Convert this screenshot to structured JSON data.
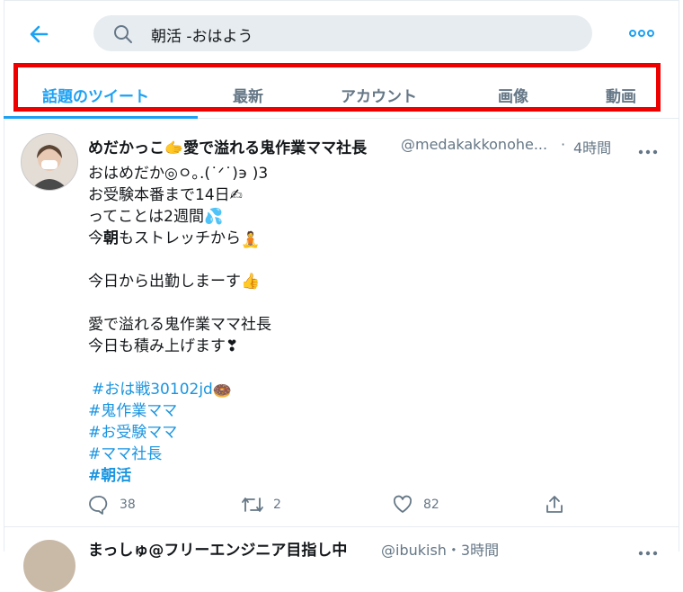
{
  "header": {
    "back_icon": "arrow-left-icon",
    "search_query": "朝活 -おはよう",
    "more_icon": "more-horizontal-icon"
  },
  "tabs": [
    {
      "label": "話題のツイート",
      "active": true
    },
    {
      "label": "最新",
      "active": false
    },
    {
      "label": "アカウント",
      "active": false
    },
    {
      "label": "画像",
      "active": false
    },
    {
      "label": "動画",
      "active": false
    }
  ],
  "tweet": {
    "display_name": "めだかっこ🫱愛で溢れる鬼作業ママ社長",
    "handle": "@medakakkonohe...",
    "separator": "·",
    "time": "4時間",
    "lines": [
      "おはめだか◎ㅇ｡.(˙ᐟ˙)϶ )3",
      "お受験本番まで14日✍",
      "ってことは2週間💦",
      "今朝もストレッチから🧘",
      "",
      "今日から出勤しまーす👍",
      "",
      "愛で溢れる鬼作業ママ社長",
      "今日も積み上げます❣",
      "",
      "#おは戦30102jd🍩",
      "#鬼作業ママ",
      "#お受験ママ",
      "#ママ社長",
      "#朝活"
    ],
    "line3_prefix": "今",
    "line3_bold": "朝",
    "line3_suffix": "もストレッチから",
    "hashtags": {
      "h1": "#おは戦30102jd",
      "h2": "#鬼作業ママ",
      "h3": "#お受験ママ",
      "h4": "#ママ社長",
      "h5": "#朝活"
    },
    "actions": {
      "reply_count": "38",
      "retweet_count": "2",
      "like_count": "82"
    }
  },
  "next_tweet": {
    "display_name": "まっしゅ@フリーエンジニア目指し中",
    "handle": "@ibukish・3時間"
  }
}
